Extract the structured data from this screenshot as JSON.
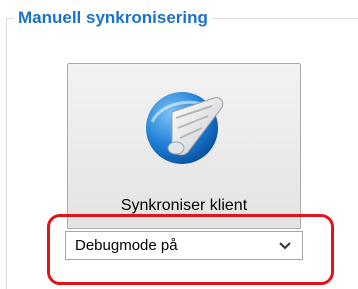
{
  "group": {
    "title": "Manuell synkronisering"
  },
  "sync_button": {
    "label": "Synkroniser klient",
    "icon": "sync-scroll-globe-icon"
  },
  "debug_select": {
    "selected": "Debugmode på",
    "icon": "chevron-down-icon"
  },
  "colors": {
    "title_blue": "#1a73c8",
    "highlight_red": "#e0141a",
    "icon_blue": "#1e7fd6"
  }
}
